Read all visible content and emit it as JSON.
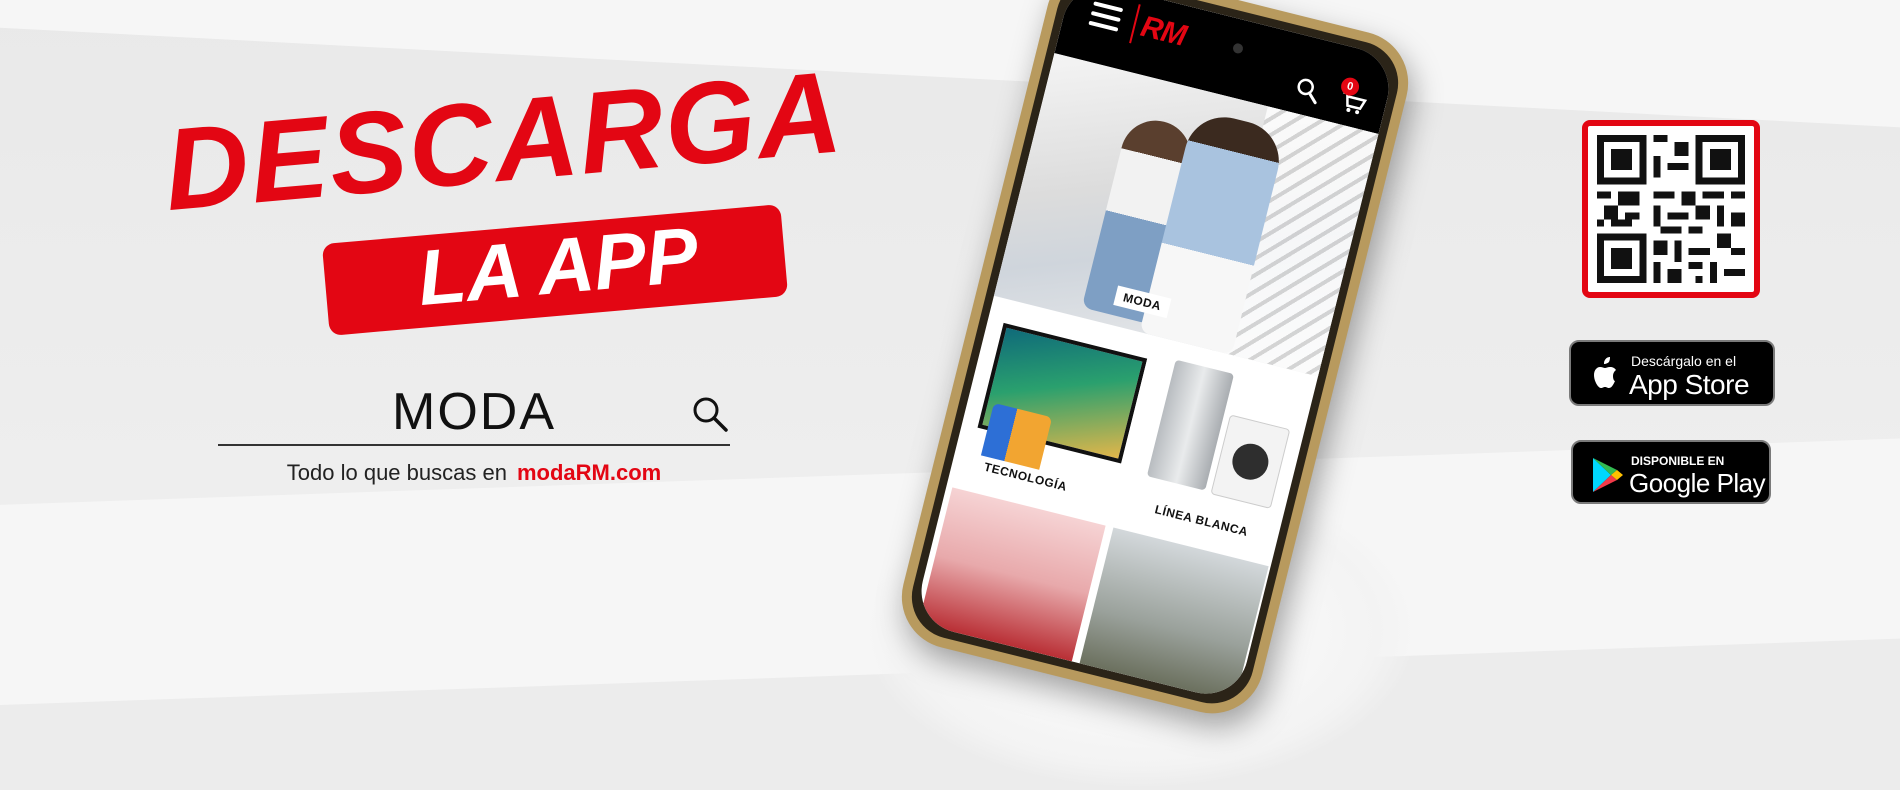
{
  "headline": {
    "line1": "DESCARGA",
    "line2": "LA APP"
  },
  "search": {
    "value": "MODA",
    "tagline_prefix": "Todo lo que buscas en",
    "tagline_brand": "modaRM.com"
  },
  "phone": {
    "logo": "RM",
    "cart_count": "0",
    "tiles": {
      "moda": "MODA",
      "tecnologia": "TECNOLOGÍA",
      "linea_blanca": "LÍNEA BLANCA"
    }
  },
  "stores": {
    "appstore": {
      "small": "Descárgalo en el",
      "big": "App Store"
    },
    "googleplay": {
      "small": "DISPONIBLE EN",
      "big": "Google Play"
    }
  },
  "colors": {
    "brand_red": "#e30613",
    "text_dark": "#111111",
    "store_bg": "#000000"
  },
  "icons": [
    "search-icon",
    "menu-icon",
    "cart-icon",
    "apple-icon",
    "google-play-icon",
    "qr-code"
  ]
}
